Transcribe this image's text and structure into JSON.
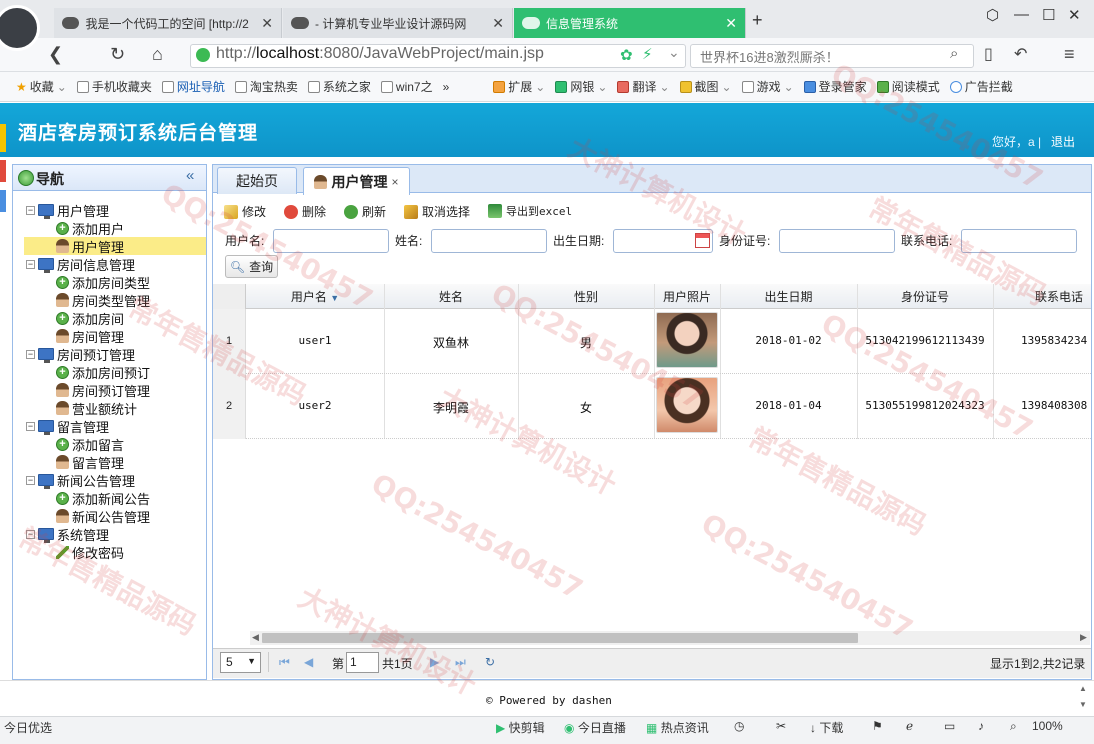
{
  "browser": {
    "tabs": [
      {
        "title": "我是一个代码工的空间 [http://2",
        "active": false
      },
      {
        "title": "计算机专业毕业设计源码网",
        "active": false
      },
      {
        "title": "信息管理系统",
        "active": true
      }
    ],
    "url_prefix": "http://",
    "url_host": "localhost",
    "url_rest": ":8080/JavaWebProject/main.jsp",
    "search_placeholder": "世界杯16进8激烈厮杀！",
    "bookmarks": [
      "收藏",
      "手机收藏夹",
      "网址导航",
      "淘宝热卖",
      "系统之家",
      "win7之",
      "扩展",
      "网银",
      "翻译",
      "截图",
      "游戏",
      "登录管家",
      "阅读模式",
      "广告拦截"
    ],
    "more_glyph": "»"
  },
  "app": {
    "title": "酒店客房预订系统后台管理",
    "greeting": "您好，a",
    "separator": "|",
    "logout": "退出"
  },
  "sidebar": {
    "title": "导航",
    "collapse_glyph": "«",
    "groups": [
      {
        "label": "用户管理",
        "items": [
          "添加用户",
          "用户管理"
        ]
      },
      {
        "label": "房间信息管理",
        "items": [
          "添加房间类型",
          "房间类型管理",
          "添加房间",
          "房间管理"
        ]
      },
      {
        "label": "房间预订管理",
        "items": [
          "添加房间预订",
          "房间预订管理",
          "营业额统计"
        ]
      },
      {
        "label": "留言管理",
        "items": [
          "添加留言",
          "留言管理"
        ]
      },
      {
        "label": "新闻公告管理",
        "items": [
          "添加新闻公告",
          "新闻公告管理"
        ]
      },
      {
        "label": "系统管理",
        "items": [
          "修改密码"
        ]
      }
    ],
    "selected": "用户管理"
  },
  "panel": {
    "tabs": [
      {
        "label": "起始页"
      },
      {
        "label": "用户管理",
        "close": "×"
      }
    ],
    "toolbar": [
      "修改",
      "删除",
      "刷新",
      "取消选择",
      "导出到excel"
    ],
    "filters": [
      {
        "label": "用户名:",
        "value": ""
      },
      {
        "label": "姓名:",
        "value": ""
      },
      {
        "label": "出生日期:",
        "value": ""
      },
      {
        "label": "身份证号:",
        "value": ""
      },
      {
        "label": "联系电话:",
        "value": ""
      }
    ],
    "query_button": "查询"
  },
  "grid": {
    "columns": [
      "用户名",
      "姓名",
      "性别",
      "用户照片",
      "出生日期",
      "身份证号",
      "联系电话"
    ],
    "sort_indicator": "▼",
    "rows": [
      {
        "n": "1",
        "username": "user1",
        "name": "双鱼林",
        "gender": "男",
        "birth": "2018-01-02",
        "idcard": "513042199612113439",
        "phone": "1395834234"
      },
      {
        "n": "2",
        "username": "user2",
        "name": "李明霞",
        "gender": "女",
        "birth": "2018-01-04",
        "idcard": "513055199812024323",
        "phone": "1398408308"
      }
    ]
  },
  "pager": {
    "page_size": "5",
    "page_prefix": "第",
    "page_value": "1",
    "page_total": "共1页",
    "summary": "显示1到2,共2记录"
  },
  "footer": {
    "powered": "Powered by dashen",
    "copyright_glyph": "©"
  },
  "statusbar": {
    "left": "今日优选",
    "items": [
      "快剪辑",
      "今日直播",
      "热点资讯",
      "下载"
    ],
    "zoom": "100%"
  },
  "watermarks": [
    "QQ:254540457",
    "大神计算机设计",
    "常年售精品源码"
  ]
}
